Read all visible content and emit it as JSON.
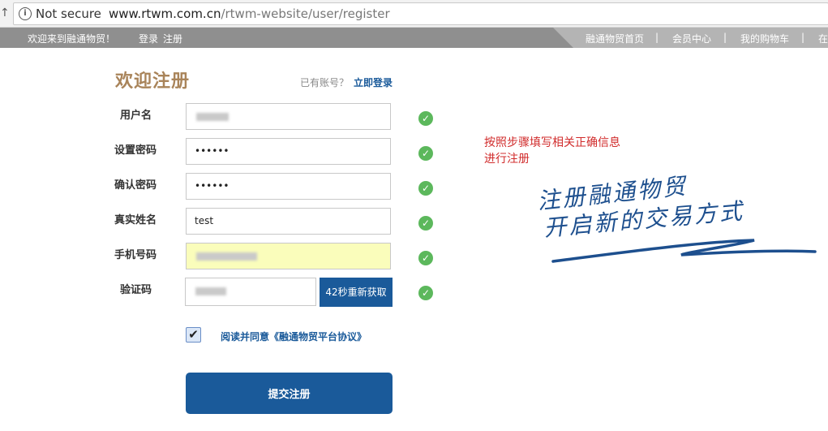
{
  "browser": {
    "back_glyph": "↑",
    "info_glyph": "i",
    "security_label": "Not secure",
    "url_host": "www.rtwm.com.cn",
    "url_path": "/rtwm-website/user/register"
  },
  "topbar": {
    "welcome": "欢迎来到融通物贸！",
    "login": "登录",
    "register": "注册",
    "nav": [
      "融通物贸首页",
      "会员中心",
      "我的购物车",
      "在"
    ],
    "separator": "|"
  },
  "form": {
    "title": "欢迎注册",
    "have_account": "已有账号？",
    "login_link": "立即登录",
    "fields": [
      {
        "label": "用户名",
        "value": ""
      },
      {
        "label": "设置密码",
        "value": "••••••"
      },
      {
        "label": "确认密码",
        "value": "••••••"
      },
      {
        "label": "真实姓名",
        "value": "test"
      },
      {
        "label": "手机号码",
        "value": ""
      },
      {
        "label": "验证码",
        "value": ""
      }
    ],
    "check_glyph": "✓",
    "resend_label": "42秒重新获取",
    "agree_checked_glyph": "✔",
    "agree_text": "阅读并同意《融通物贸平台协议》",
    "submit_label": "提交注册"
  },
  "annotation": {
    "line1": "按照步骤填写相关正确信息",
    "line2": "进行注册"
  },
  "slogan": {
    "line1": "注册融通物贸",
    "line2": "开启新的交易方式"
  },
  "colors": {
    "brand_blue": "#1a5a9a",
    "title_gold": "#a9845a",
    "check_green": "#5cb85c",
    "annotation_red": "#d12c2c",
    "topbar_gray": "#8f8f8f"
  }
}
